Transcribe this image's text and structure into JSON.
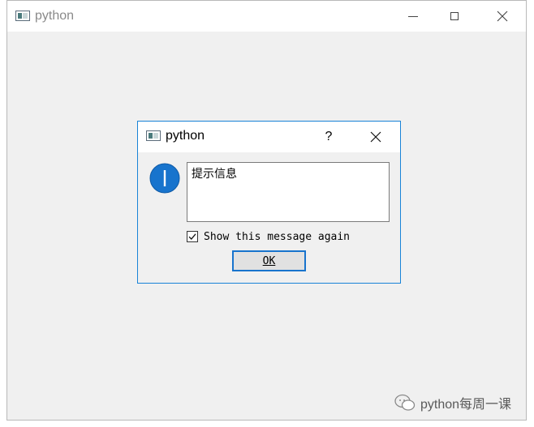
{
  "main_window": {
    "title": "python"
  },
  "dialog": {
    "title": "python",
    "help_label": "?",
    "message": "提示信息",
    "checkbox_label": "Show this message again",
    "checkbox_checked": true,
    "ok_label": "OK"
  },
  "watermark": {
    "text": "python每周一课"
  },
  "colors": {
    "accent": "#1883d7",
    "info_icon": "#1874cd",
    "window_bg": "#f0f0f0"
  },
  "icons": {
    "app": "python-app-icon",
    "minimize": "minimize-icon",
    "maximize": "maximize-icon",
    "close": "close-icon",
    "info": "information-icon",
    "checkmark": "checkmark-icon",
    "wechat": "wechat-icon"
  }
}
